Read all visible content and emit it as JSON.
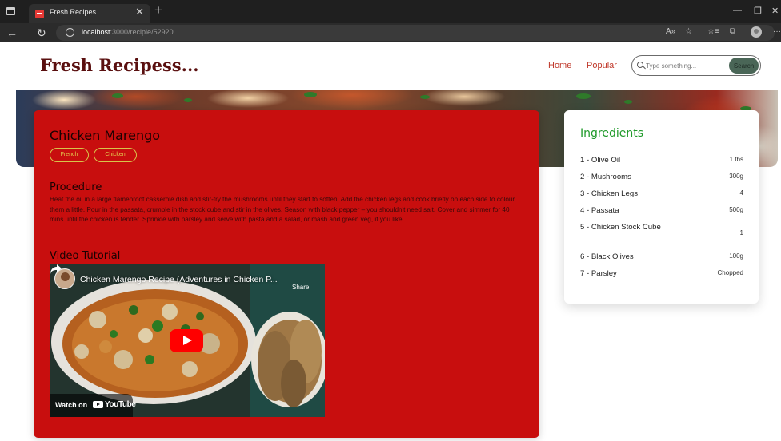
{
  "browser": {
    "tab_title": "Fresh Recipes",
    "tab_close": "✕",
    "new_tab": "+",
    "minimize": "—",
    "restore": "❐",
    "close": "✕",
    "back": "←",
    "reload": "↻",
    "url_host": "localhost",
    "url_path": ":3000/recipie/52920",
    "read_aloud": "A»",
    "favorites_add": "☆",
    "favorites": "☆≡",
    "collections": "⧉",
    "more": "···"
  },
  "site": {
    "logo": "Fresh Recipess...",
    "nav": {
      "home": "Home",
      "popular": "Popular"
    },
    "search": {
      "placeholder": "Type something...",
      "button": "Search"
    }
  },
  "recipe": {
    "title": "Chicken Marengo",
    "tags": [
      "French",
      "Chicken"
    ],
    "procedure_heading": "Procedure",
    "procedure": "Heat the oil in a large flameproof casserole dish and stir-fry the mushrooms until they start to soften. Add the chicken legs and cook briefly on each side to colour them a little. Pour in the passata, crumble in the stock cube and stir in the olives. Season with black pepper – you shouldn't need salt. Cover and simmer for 40 mins until the chicken is tender. Sprinkle with parsley and serve with pasta and a salad, or mash and green veg, if you like.",
    "video_heading": "Video Tutorial",
    "video": {
      "title": "Chicken Marengo Recipe (Adventures in Chicken P...",
      "share": "Share",
      "watch_on": "Watch on",
      "youtube": "YouTube"
    }
  },
  "ingredients": {
    "title": "Ingredients",
    "items": [
      {
        "name": "1 - Olive Oil",
        "qty": "1 tbs"
      },
      {
        "name": "2 - Mushrooms",
        "qty": "300g"
      },
      {
        "name": "3 - Chicken Legs",
        "qty": "4"
      },
      {
        "name": "4 - Passata",
        "qty": "500g"
      },
      {
        "name": "5 - Chicken Stock Cube",
        "qty": "1"
      },
      {
        "name": "6 - Black Olives",
        "qty": "100g"
      },
      {
        "name": "7 - Parsley",
        "qty": "Chopped"
      }
    ]
  }
}
